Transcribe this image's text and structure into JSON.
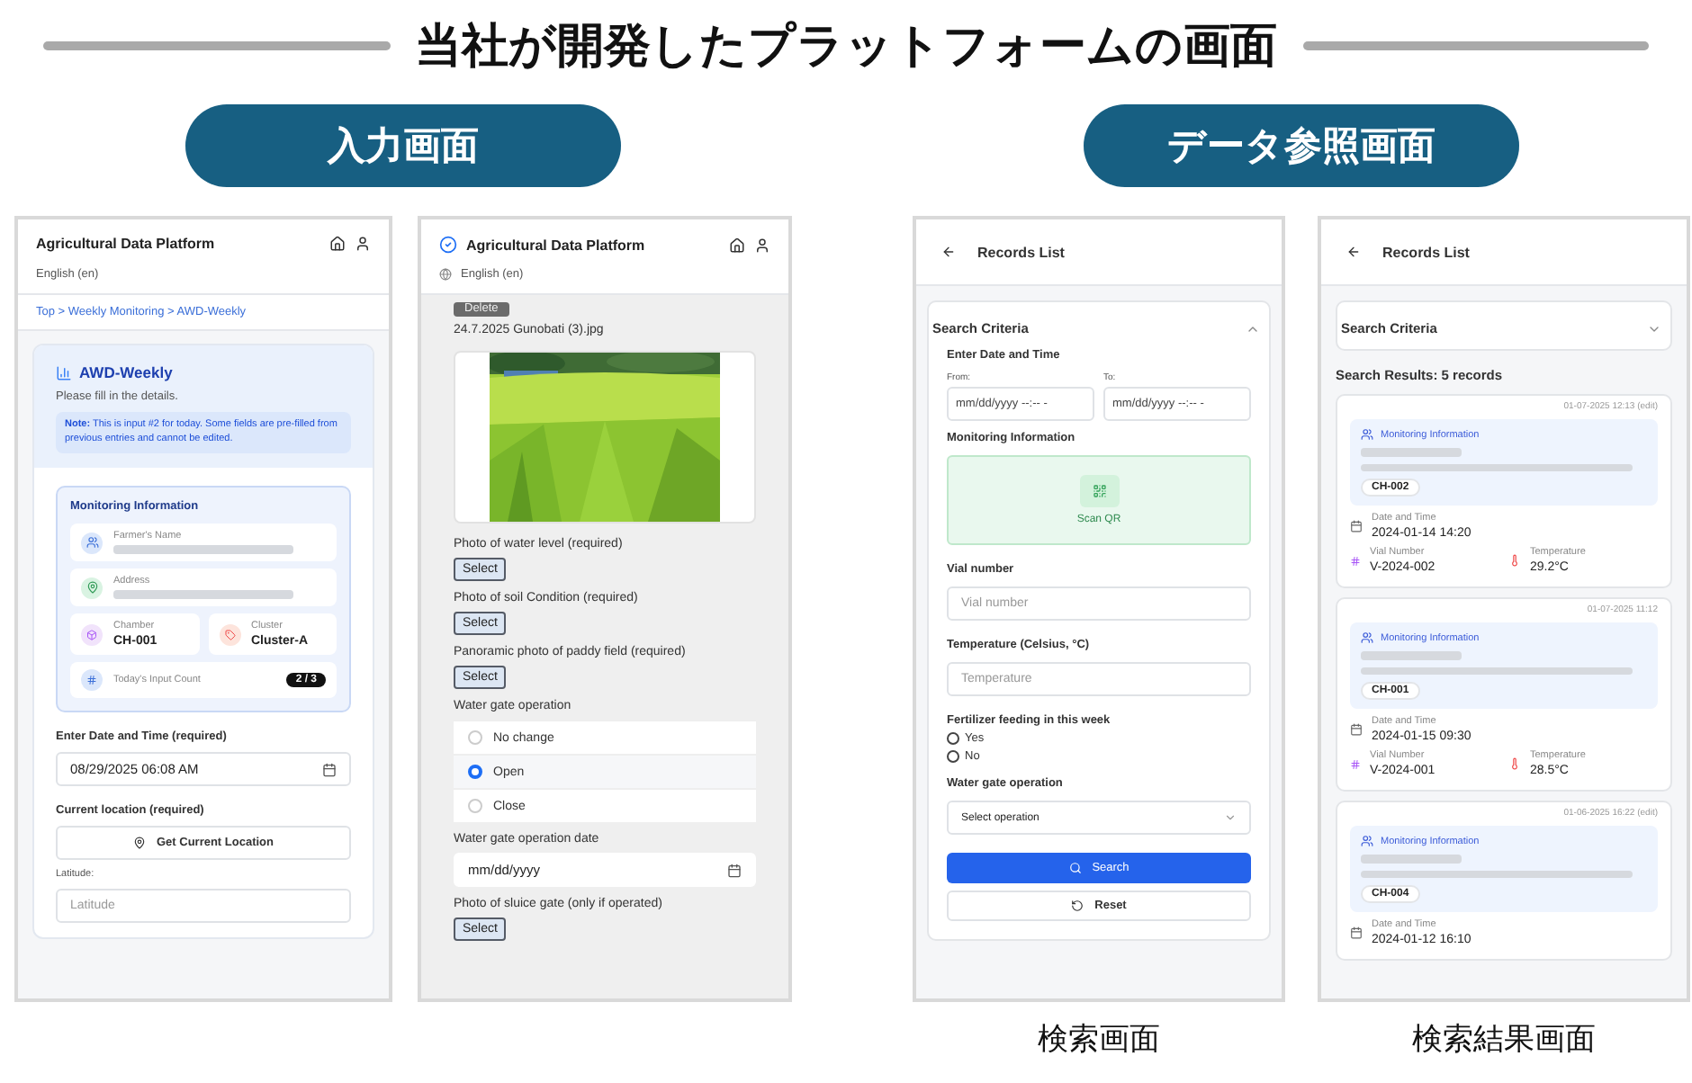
{
  "title": "当社が開発したプラットフォームの画面",
  "sections": [
    {
      "label": "入力画面"
    },
    {
      "label": "データ参照画面"
    }
  ],
  "screens": [
    {
      "kind": "entry",
      "app_title": "Agricultural Data Platform",
      "language": "English (en)",
      "breadcrumb": "Top > Weekly Monitoring > AWD-Weekly",
      "form_title": "AWD-Weekly",
      "subtitle": "Please fill in the details.",
      "note": "**Note:** This is input #2 for today. Some fields are pre-filled from previous entries and cannot be edited.",
      "monitoring_title": "Monitoring Information",
      "info_rows": [
        {
          "kind": "farmer",
          "label": "Farmer's Name",
          "blurred": true
        },
        {
          "kind": "address",
          "label": "Address",
          "blurred": true
        }
      ],
      "chamber": {
        "label": "Chamber",
        "value": "CH-001"
      },
      "cluster": {
        "label": "Cluster",
        "value": "Cluster-A"
      },
      "input_count": {
        "label": "Today's Input Count",
        "value": "2 / 3"
      },
      "date_label": "Enter Date and Time (required)",
      "date_value": "08/29/2025 06:08 AM",
      "location_label": "Current location (required)",
      "location_button": "Get Current Location",
      "latitude_label": "Latitude:",
      "latitude_placeholder": "Latitude"
    },
    {
      "kind": "photos",
      "app_title": "Agricultural Data Platform",
      "language": "English (en)",
      "delete_button": "Delete",
      "file_name": "24.7.2025 Gunobati (3).jpg",
      "fields": [
        {
          "label": "Photo of water level  (required)",
          "button": "Select"
        },
        {
          "label": "Photo of soil Condition  (required)",
          "button": "Select"
        },
        {
          "label": "Panoramic photo of paddy field  (required)",
          "button": "Select"
        },
        {
          "kind": "radio",
          "label": "Water gate operation",
          "options": [
            {
              "label": "No change",
              "selected": false
            },
            {
              "label": "Open",
              "selected": true
            },
            {
              "label": "Close",
              "selected": false
            }
          ]
        },
        {
          "kind": "date",
          "label": "Water gate operation date",
          "placeholder": "mm/dd/yyyy"
        },
        {
          "label": "Photo of sluice gate (only if operated)",
          "button": "Select"
        }
      ]
    },
    {
      "kind": "search",
      "header": "Records List",
      "criteria_title": "Search Criteria",
      "expanded": true,
      "caption": "検索画面",
      "date_label": "Enter Date and Time",
      "from_label": "From:",
      "to_label": "To:",
      "from_placeholder": "mm/dd/yyyy --:-- -",
      "to_placeholder": "mm/dd/yyyy --:-- -",
      "monitoring_label": "Monitoring Information",
      "scan_label": "Scan QR",
      "vial_label": "Vial number",
      "vial_placeholder": "Vial number",
      "temp_label": "Temperature (Celsius, °C)",
      "temp_placeholder": "Temperature",
      "fertilizer_label": "Fertilizer feeding in this week",
      "fertilizer_options": [
        {
          "label": "Yes",
          "selected": false
        },
        {
          "label": "No",
          "selected": false
        }
      ],
      "gate_label": "Water gate operation",
      "gate_placeholder": "Select operation",
      "search_button": "Search",
      "reset_button": "Reset"
    },
    {
      "kind": "results",
      "header": "Records List",
      "criteria_title": "Search Criteria",
      "expanded": false,
      "caption": "検索結果画面",
      "results_title": "Search Results: 5 records",
      "records": [
        {
          "timestamp": "01-07-2025 12:13 (edit)",
          "section": "Monitoring Information",
          "chamber": "CH-002",
          "date_label": "Date and Time",
          "date": "2024-01-14 14:20",
          "vial_label": "Vial Number",
          "vial": "V-2024-002",
          "temp_label": "Temperature",
          "temp": "29.2°C"
        },
        {
          "timestamp": "01-07-2025 11:12",
          "section": "Monitoring Information",
          "chamber": "CH-001",
          "date_label": "Date and Time",
          "date": "2024-01-15 09:30",
          "vial_label": "Vial Number",
          "vial": "V-2024-001",
          "temp_label": "Temperature",
          "temp": "28.5°C"
        },
        {
          "timestamp": "01-06-2025 16:22 (edit)",
          "section": "Monitoring Information",
          "chamber": "CH-004",
          "date_label": "Date and Time",
          "date": "2024-01-12 16:10"
        }
      ]
    }
  ]
}
